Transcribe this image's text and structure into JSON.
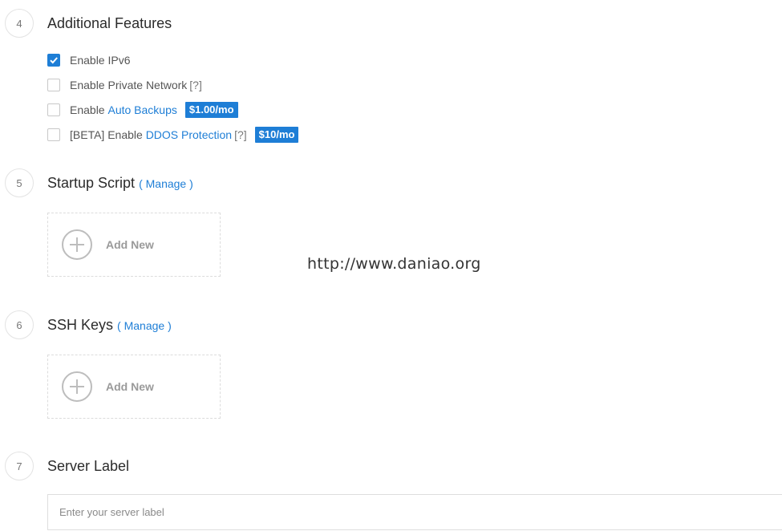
{
  "sections": {
    "additional_features": {
      "number": "4",
      "title": "Additional Features",
      "options": [
        {
          "checked": true,
          "text": "Enable IPv6"
        },
        {
          "checked": false,
          "text": "Enable Private Network",
          "help": "[?]"
        },
        {
          "checked": false,
          "prefix": "Enable ",
          "link": "Auto Backups",
          "badge": "$1.00/mo"
        },
        {
          "checked": false,
          "prefix": "[BETA] Enable ",
          "link": "DDOS Protection",
          "help": "[?]",
          "badge": "$10/mo"
        }
      ]
    },
    "startup_script": {
      "number": "5",
      "title": "Startup Script",
      "manage": "( Manage )",
      "add_label": "Add New"
    },
    "ssh_keys": {
      "number": "6",
      "title": "SSH Keys",
      "manage": "( Manage )",
      "add_label": "Add New"
    },
    "server_label": {
      "number": "7",
      "title": "Server Label",
      "placeholder": "Enter your server label",
      "value": ""
    }
  },
  "watermark": "http://www.daniao.org",
  "icons": {
    "check": "check-icon",
    "add": "plus-circle-icon"
  },
  "colors": {
    "accent": "#1e7ed6",
    "muted": "#9a9a9a"
  }
}
